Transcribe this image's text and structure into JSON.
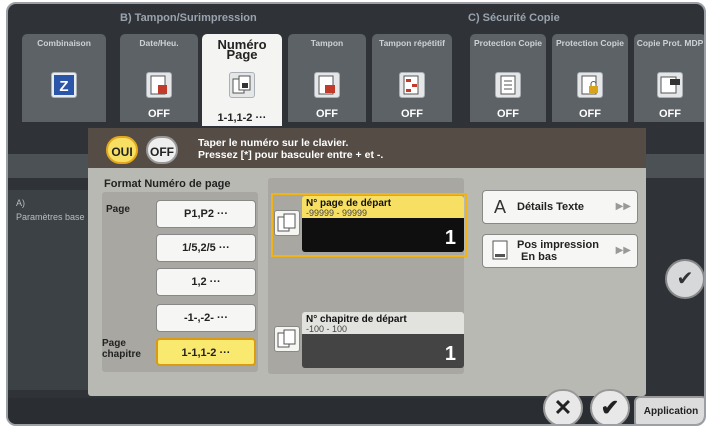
{
  "header": {
    "section_b": "B) Tampon/Surimpression",
    "section_c": "C) Sécurité Copie"
  },
  "function_tabs": [
    {
      "label": "Combinaison",
      "value": ""
    },
    {
      "label": "Date/Heu.",
      "value": "OFF"
    },
    {
      "label": "Numéro Page",
      "value": "1-1,1-2 ···"
    },
    {
      "label": "Tampon",
      "value": "OFF"
    },
    {
      "label": "Tampon répétitif",
      "value": "OFF"
    },
    {
      "label": "Protection Copie",
      "value": "OFF"
    },
    {
      "label": "Protection Copie",
      "value": "OFF"
    },
    {
      "label": "Copie Prot. MDP",
      "value": "OFF"
    }
  ],
  "background": {
    "left_label": "A)",
    "left_sublabel": "Paramètres base"
  },
  "dialog": {
    "oui": "OUI",
    "off": "OFF",
    "instruction_line1": "Taper le numéro sur le clavier.",
    "instruction_line2": "Pressez [*] pour basculer entre + et -.",
    "group_title": "Format Numéro de page",
    "label_page": "Page",
    "label_chapitre_line1": "Page",
    "label_chapitre_line2": "chapitre",
    "formats": [
      "P1,P2 ···",
      "1/5,2/5 ···",
      "1,2 ···",
      "-1-,-2- ···",
      "1-1,1-2 ···"
    ],
    "start_page": {
      "title": "N° page de départ",
      "range": "-99999 - 99999",
      "value": "1"
    },
    "start_chapter": {
      "title": "N° chapitre de départ",
      "range": "-100 - 100",
      "value": "1"
    },
    "details_texte": "Détails Texte",
    "pos_impression_line1": "Pos impression",
    "pos_impression_line2": "En bas"
  },
  "footer": {
    "application": "Application"
  }
}
